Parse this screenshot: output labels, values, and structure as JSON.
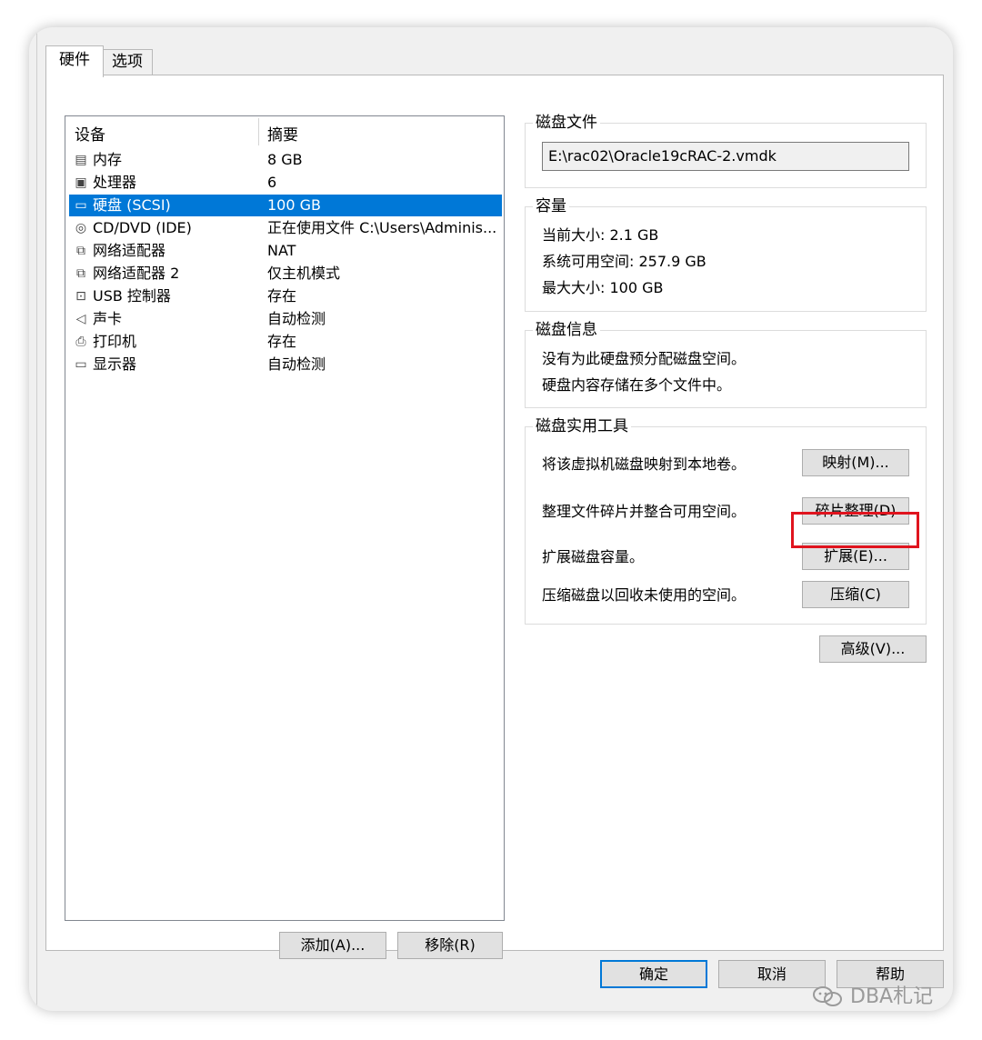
{
  "tabs": [
    {
      "label": "硬件",
      "active": true
    },
    {
      "label": "选项",
      "active": false
    }
  ],
  "device_list": {
    "headers": {
      "device": "设备",
      "summary": "摘要"
    },
    "rows": [
      {
        "icon": "memory-icon",
        "device": "内存",
        "summary": "8 GB",
        "selected": false
      },
      {
        "icon": "processor-icon",
        "device": "处理器",
        "summary": "6",
        "selected": false
      },
      {
        "icon": "hard-disk-icon",
        "device": "硬盘 (SCSI)",
        "summary": "100 GB",
        "selected": true
      },
      {
        "icon": "cd-dvd-icon",
        "device": "CD/DVD (IDE)",
        "summary": "正在使用文件 C:\\Users\\Adminis...",
        "selected": false
      },
      {
        "icon": "network-adapter-icon",
        "device": "网络适配器",
        "summary": "NAT",
        "selected": false
      },
      {
        "icon": "network-adapter-icon",
        "device": "网络适配器 2",
        "summary": "仅主机模式",
        "selected": false
      },
      {
        "icon": "usb-icon",
        "device": "USB 控制器",
        "summary": "存在",
        "selected": false
      },
      {
        "icon": "sound-card-icon",
        "device": "声卡",
        "summary": "自动检测",
        "selected": false
      },
      {
        "icon": "printer-icon",
        "device": "打印机",
        "summary": "存在",
        "selected": false
      },
      {
        "icon": "display-icon",
        "device": "显示器",
        "summary": "自动检测",
        "selected": false
      }
    ],
    "add_label": "添加(A)...",
    "remove_label": "移除(R)"
  },
  "disk_file": {
    "title": "磁盘文件",
    "path": "E:\\rac02\\Oracle19cRAC-2.vmdk"
  },
  "capacity": {
    "title": "容量",
    "current_size": "当前大小: 2.1 GB",
    "free_space": "系统可用空间: 257.9 GB",
    "max_size": "最大大小: 100 GB"
  },
  "disk_info": {
    "title": "磁盘信息",
    "line1": "没有为此硬盘预分配磁盘空间。",
    "line2": "硬盘内容存储在多个文件中。"
  },
  "disk_utilities": {
    "title": "磁盘实用工具",
    "map_text": "将该虚拟机磁盘映射到本地卷。",
    "map_button": "映射(M)...",
    "defrag_text": "整理文件碎片并整合可用空间。",
    "defrag_button": "碎片整理(D)",
    "expand_text": "扩展磁盘容量。",
    "expand_button": "扩展(E)...",
    "compact_text": "压缩磁盘以回收未使用的空间。",
    "compact_button": "压缩(C)"
  },
  "advanced_button": "高级(V)...",
  "footer": {
    "ok": "确定",
    "cancel": "取消",
    "help": "帮助"
  },
  "watermark": "DBA札记",
  "colors": {
    "selection": "#0078d7",
    "highlight_box": "#e0141e"
  }
}
